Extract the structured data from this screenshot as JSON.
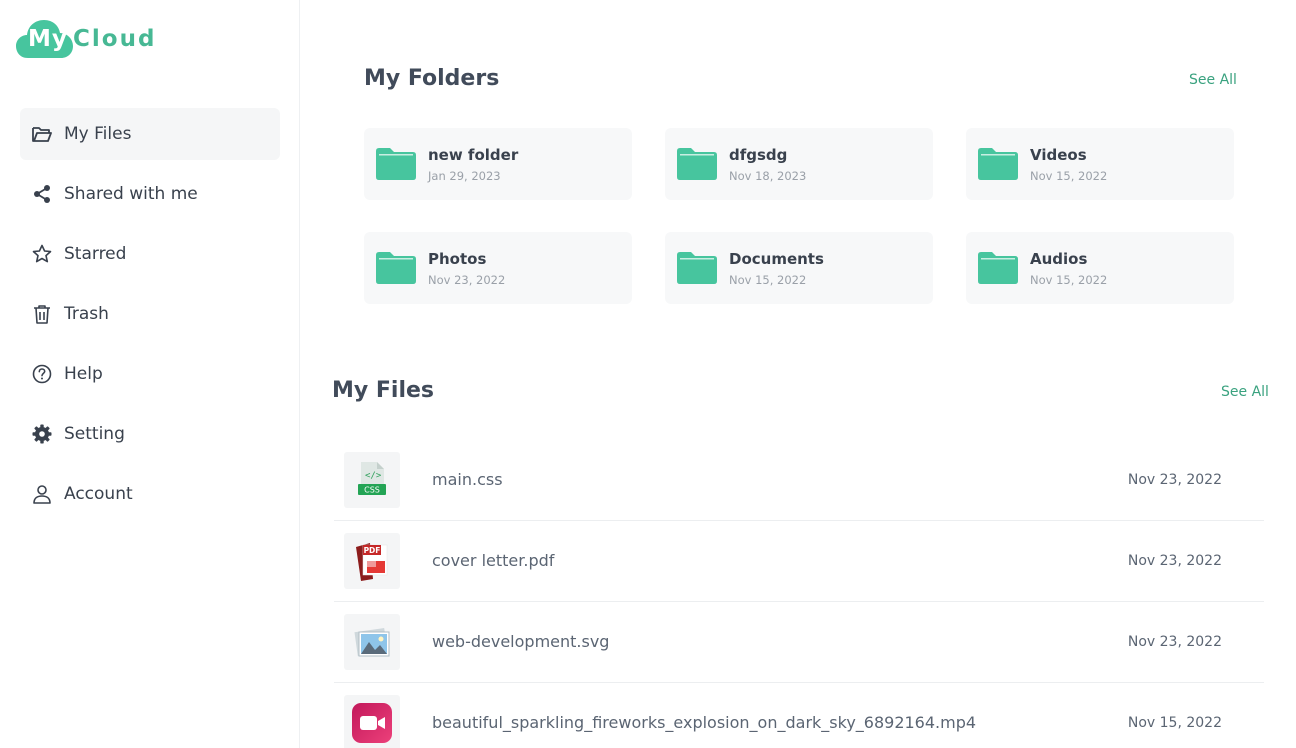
{
  "app": {
    "logo_my": "My",
    "logo_cloud": "Cloud"
  },
  "colors": {
    "accent": "#47c59e",
    "link": "#3aa27f",
    "text": "#39414d"
  },
  "sidebar": {
    "items": [
      {
        "label": "My Files",
        "icon": "folder-open-icon",
        "active": true
      },
      {
        "label": "Shared with me",
        "icon": "share-icon",
        "active": false
      },
      {
        "label": "Starred",
        "icon": "star-icon",
        "active": false
      },
      {
        "label": "Trash",
        "icon": "trash-icon",
        "active": false
      },
      {
        "label": "Help",
        "icon": "help-icon",
        "active": false
      },
      {
        "label": "Setting",
        "icon": "gear-icon",
        "active": false
      },
      {
        "label": "Account",
        "icon": "user-icon",
        "active": false
      }
    ]
  },
  "folders": {
    "title": "My Folders",
    "see_all": "See All",
    "items": [
      {
        "name": "new folder",
        "date": "Jan 29, 2023"
      },
      {
        "name": "dfgsdg",
        "date": "Nov 18, 2023"
      },
      {
        "name": "Videos",
        "date": "Nov 15, 2022"
      },
      {
        "name": "Photos",
        "date": "Nov 23, 2022"
      },
      {
        "name": "Documents",
        "date": "Nov 15, 2022"
      },
      {
        "name": "Audios",
        "date": "Nov 15, 2022"
      }
    ]
  },
  "files": {
    "title": "My Files",
    "see_all": "See All",
    "items": [
      {
        "name": "main.css",
        "date": "Nov 23, 2022",
        "icon": "css-file-icon",
        "badge": "CSS"
      },
      {
        "name": "cover letter.pdf",
        "date": "Nov 23, 2022",
        "icon": "pdf-file-icon",
        "badge": "PDF"
      },
      {
        "name": "web-development.svg",
        "date": "Nov 23, 2022",
        "icon": "image-file-icon"
      },
      {
        "name": "beautiful_sparkling_fireworks_explosion_on_dark_sky_6892164.mp4",
        "date": "Nov 15, 2022",
        "icon": "video-file-icon"
      }
    ]
  }
}
